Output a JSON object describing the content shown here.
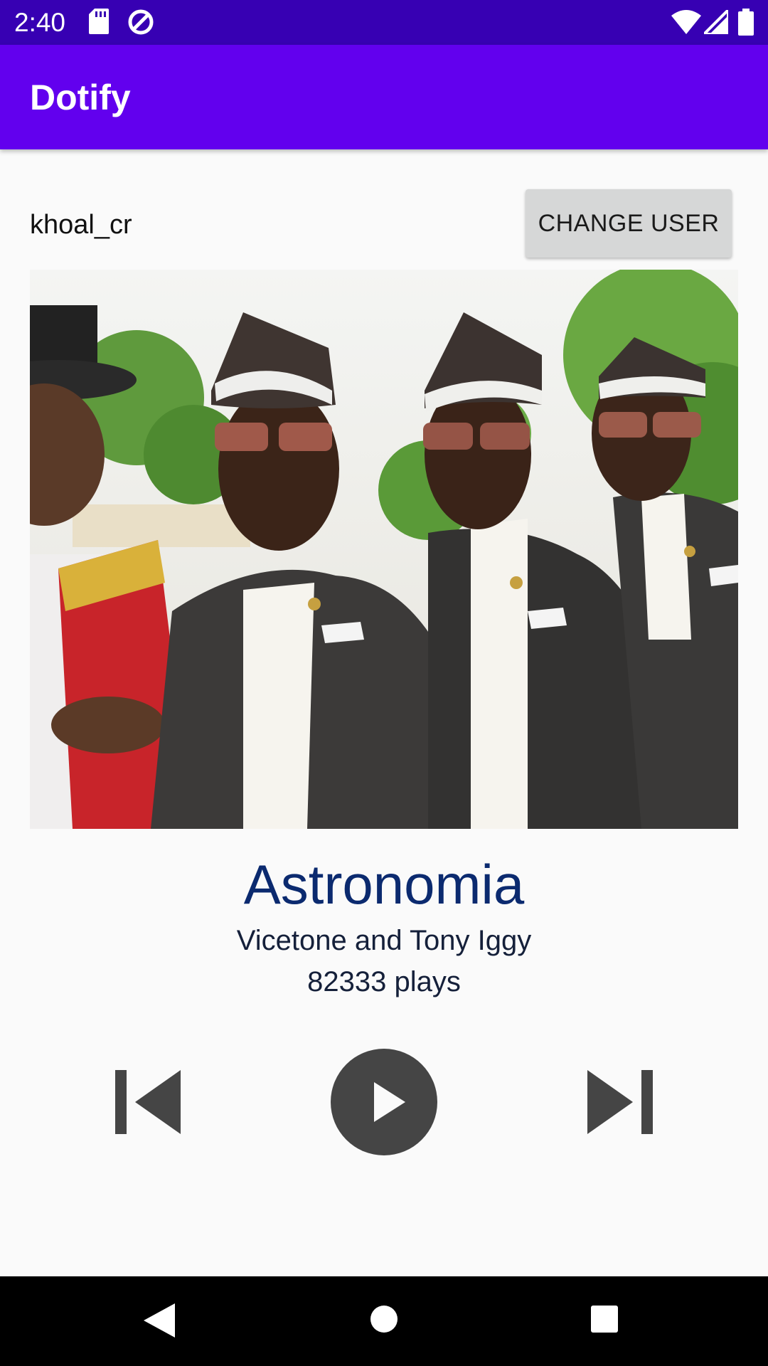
{
  "status_bar": {
    "time": "2:40",
    "left_icons": [
      "sd-card-icon",
      "data-saver-icon"
    ],
    "right_icons": [
      "wifi-icon",
      "cell-signal-icon",
      "battery-icon"
    ]
  },
  "app_bar": {
    "title": "Dotify"
  },
  "user": {
    "username": "khoal_cr",
    "change_user_label": "CHANGE USER"
  },
  "album": {
    "image": "album-cover-image"
  },
  "song": {
    "title": "Astronomia",
    "artist": "Vicetone and Tony Iggy",
    "plays": "82333 plays"
  },
  "controls": [
    "skip-previous-icon",
    "play-icon",
    "skip-next-icon"
  ],
  "nav": [
    "back-icon",
    "home-icon",
    "recents-icon"
  ],
  "colors": {
    "status_bar": "#3700b3",
    "app_bar": "#6200ee",
    "song_title": "#0b2a6f",
    "controls": "#454545",
    "background": "#fafafa"
  }
}
